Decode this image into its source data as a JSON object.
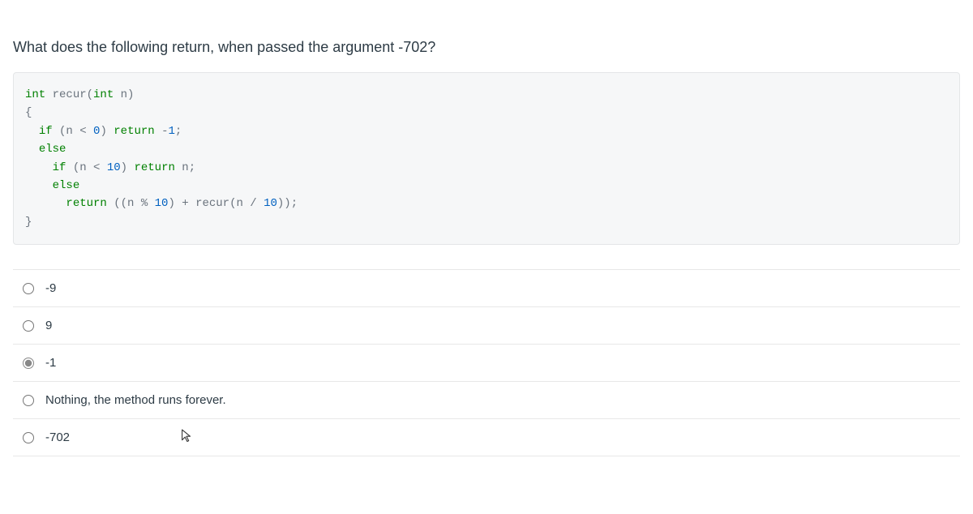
{
  "question": "What does the following return, when passed the argument -702?",
  "code_lines": {
    "l1a": "int",
    "l1b": " recur(",
    "l1c": "int",
    "l1d": " n)",
    "l2": "{",
    "l3a": "  ",
    "l3b": "if",
    "l3c": " (n < ",
    "l3d": "0",
    "l3e": ") ",
    "l3f": "return",
    "l3g": " -",
    "l3h": "1",
    "l3i": ";",
    "l4a": "  ",
    "l4b": "else",
    "l5a": "    ",
    "l5b": "if",
    "l5c": " (n < ",
    "l5d": "10",
    "l5e": ") ",
    "l5f": "return",
    "l5g": " n;",
    "l6a": "    ",
    "l6b": "else",
    "l7a": "      ",
    "l7b": "return",
    "l7c": " ((n % ",
    "l7d": "10",
    "l7e": ") + recur(n / ",
    "l7f": "10",
    "l7g": "));",
    "l8": "}"
  },
  "answers": {
    "a": "-9",
    "b": "9",
    "c": "-1",
    "d": "Nothing, the method runs forever.",
    "e": "-702"
  },
  "selected": "c"
}
